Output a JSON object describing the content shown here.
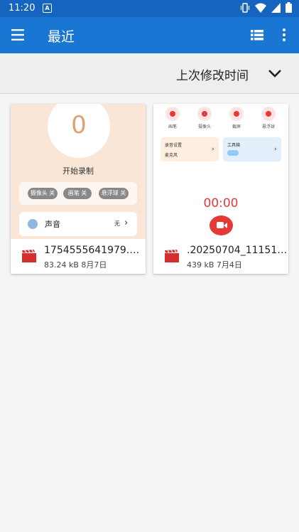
{
  "status": {
    "time": "11:20",
    "sim_label": "A"
  },
  "appbar": {
    "title": "最近"
  },
  "sort": {
    "label": "上次修改时间"
  },
  "files": [
    {
      "name": "1754555641979.…",
      "size": "83.24 kB",
      "date": "8月7日",
      "preview": {
        "counter": "0",
        "start_label": "开始录制",
        "toggles": [
          "摄像头 关",
          "画笔 关",
          "悬浮球 关"
        ],
        "sound_label": "声音",
        "sound_value": "无"
      }
    },
    {
      "name": ".20250704_11151…",
      "size": "439 kB",
      "date": "7月4日",
      "preview": {
        "tools": [
          "画笔",
          "摄像头",
          "截屏",
          "悬浮球"
        ],
        "box1_title": "录音设置",
        "box1_value": "麦克风",
        "box2_title": "工具箱",
        "timer": "00:00"
      }
    }
  ],
  "colors": {
    "primary": "#1976d2",
    "status_bar": "#1565c0",
    "accent_red": "#e53935",
    "video_icon": "#d32f2f"
  }
}
